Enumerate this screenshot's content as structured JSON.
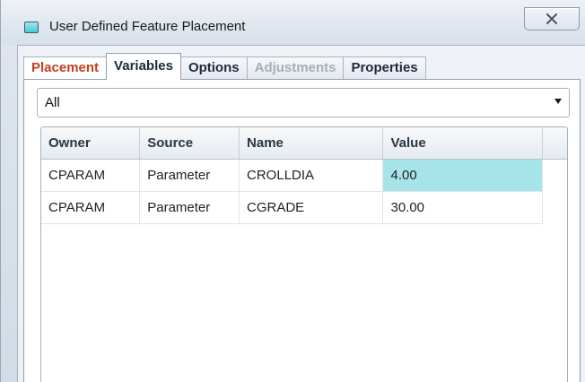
{
  "window": {
    "title": "User Defined Feature Placement"
  },
  "tabs": [
    {
      "label": "Placement",
      "state": "normal"
    },
    {
      "label": "Variables",
      "state": "active"
    },
    {
      "label": "Options",
      "state": "normal"
    },
    {
      "label": "Adjustments",
      "state": "disabled"
    },
    {
      "label": "Properties",
      "state": "normal"
    }
  ],
  "filter": {
    "selected": "All"
  },
  "table": {
    "columns": [
      "Owner",
      "Source",
      "Name",
      "Value"
    ],
    "rows": [
      {
        "owner": "CPARAM",
        "source": "Parameter",
        "name": "CROLLDIA",
        "value": "4.00",
        "selected": true
      },
      {
        "owner": "CPARAM",
        "source": "Parameter",
        "name": "CGRADE",
        "value": "30.00",
        "selected": false
      }
    ]
  },
  "colors": {
    "accent_tab": "#c0401c",
    "selected_cell": "#a6e4ea",
    "disabled_text": "#a6adb5"
  },
  "icons": {
    "window": "feature-window-icon",
    "close": "close-icon",
    "dropdown": "chevron-down-icon"
  }
}
